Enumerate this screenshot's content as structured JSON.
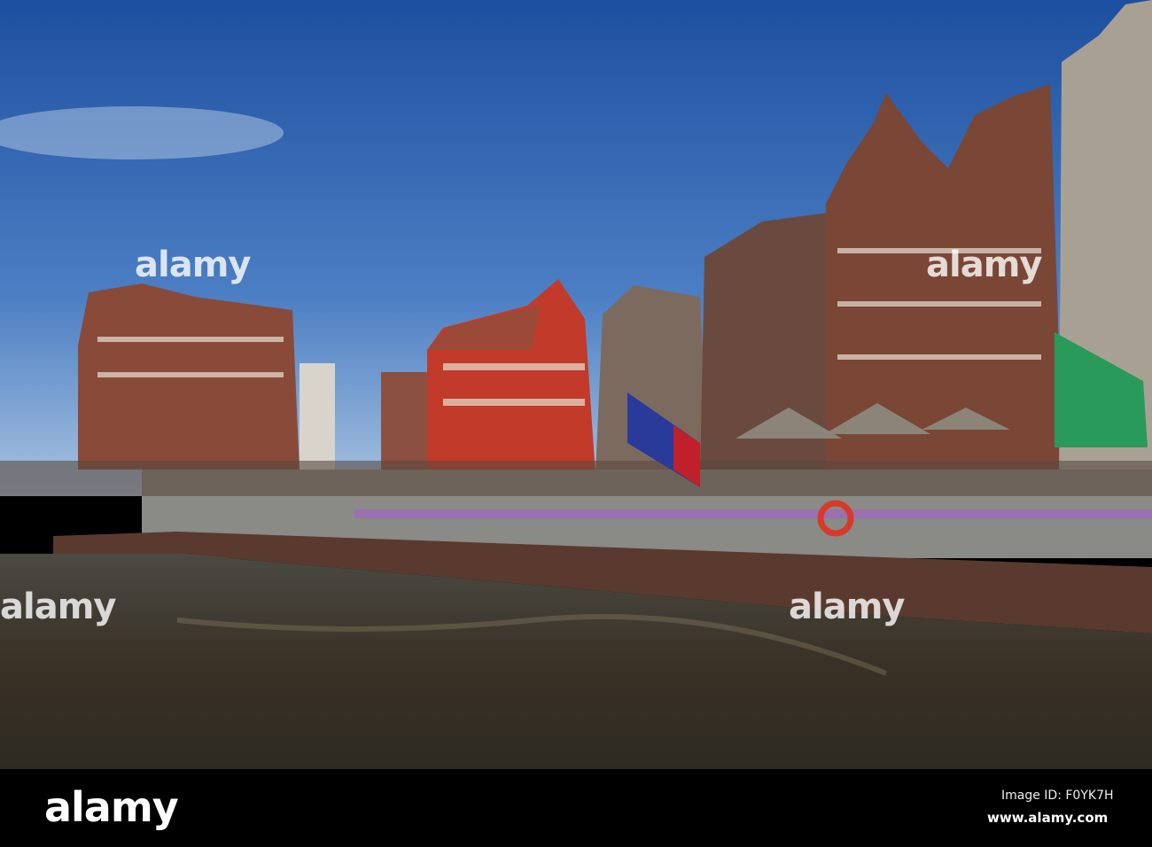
{
  "watermark": {
    "brand": "alamy"
  },
  "footer": {
    "logo": "alamy",
    "image_id": "Image ID: F0YK7H",
    "url": "www.alamy.com"
  },
  "colors": {
    "sky_top": "#1d4fa0",
    "sky_bottom": "#8fb3d9",
    "water": "#3d3428",
    "footer": "#000000"
  }
}
